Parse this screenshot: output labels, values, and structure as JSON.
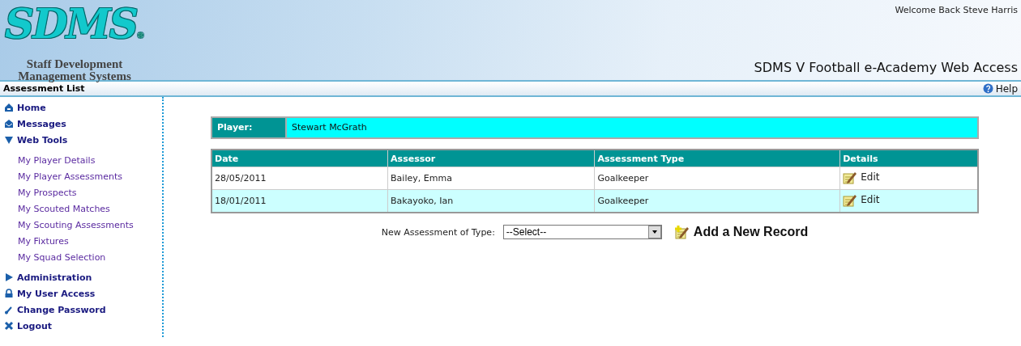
{
  "header": {
    "logo": "SDMS",
    "logo_mark": "®",
    "logo_subtitle": [
      "Staff Development",
      "Management Systems"
    ],
    "welcome": "Welcome Back Steve Harris",
    "app_title": "SDMS V Football e-Academy Web Access"
  },
  "title_bar": {
    "title": "Assessment List",
    "help": "Help"
  },
  "sidebar": {
    "items": [
      {
        "label": "Home",
        "kind": "home"
      },
      {
        "label": "Messages",
        "kind": "mail"
      },
      {
        "label": "Web Tools",
        "kind": "group",
        "expanded": true,
        "children": [
          {
            "label": "My Player Details"
          },
          {
            "label": "My Player Assessments"
          },
          {
            "label": "My Prospects"
          },
          {
            "label": "My Scouted Matches"
          },
          {
            "label": "My Scouting Assessments"
          },
          {
            "label": "My Fixtures"
          },
          {
            "label": "My Squad Selection"
          }
        ]
      },
      {
        "label": "Administration",
        "kind": "group",
        "expanded": false
      },
      {
        "label": "My User Access",
        "kind": "lock"
      },
      {
        "label": "Change Password",
        "kind": "key"
      },
      {
        "label": "Logout",
        "kind": "cross"
      }
    ]
  },
  "player": {
    "label": "Player:",
    "name": "Stewart McGrath"
  },
  "table": {
    "columns": [
      "Date",
      "Assessor",
      "Assessment Type",
      "Details"
    ],
    "rows": [
      {
        "date": "28/05/2011",
        "assessor": "Bailey, Emma",
        "type": "Goalkeeper",
        "action": "Edit"
      },
      {
        "date": "18/01/2011",
        "assessor": "Bakayoko, Ian",
        "type": "Goalkeeper",
        "action": "Edit"
      }
    ]
  },
  "new_record": {
    "label": "New Assessment of Type:",
    "value": "--Select--",
    "button": "Add a New Record"
  }
}
